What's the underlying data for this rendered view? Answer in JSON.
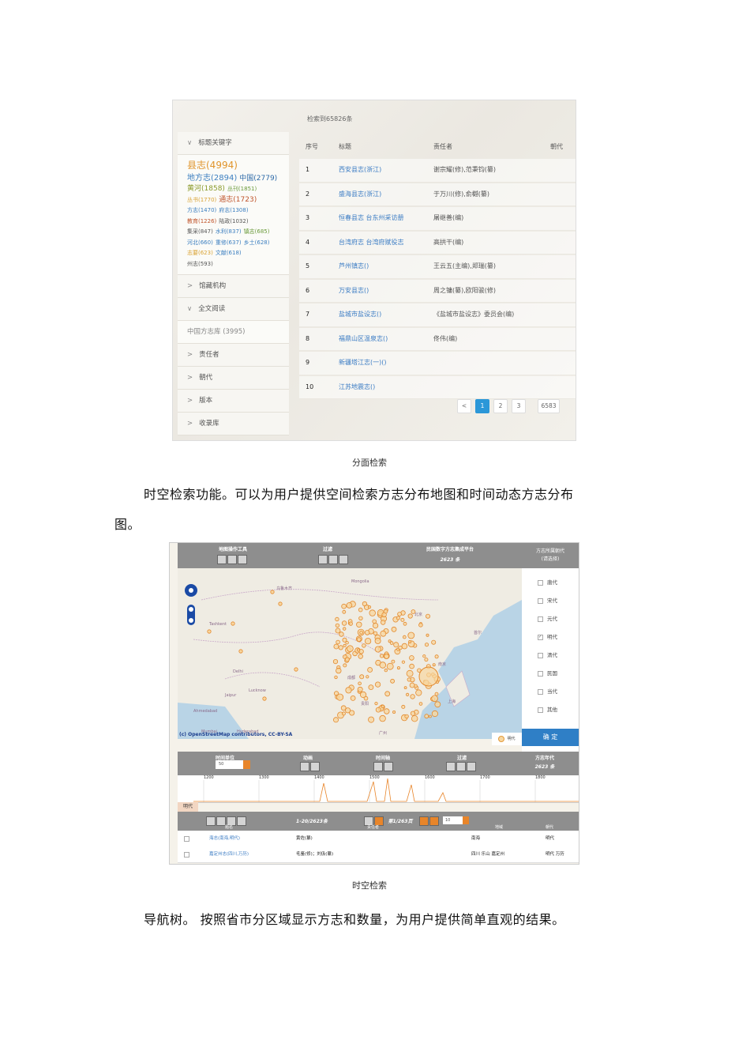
{
  "figure1": {
    "hit_count": "检索到65826条",
    "facets": {
      "title_keyword_label": "标题关键字",
      "keywords": [
        {
          "text": "县志(4994)",
          "size": "big",
          "color": "#e0952c"
        },
        {
          "text": "地方志(2894)",
          "size": "l2",
          "color": "#3c7fc0"
        },
        {
          "text": "中国(2779)",
          "size": "l3",
          "color": "#2d6aa8"
        },
        {
          "text": "黄河(1858)",
          "size": "l3",
          "color": "#8a9a2a"
        },
        {
          "text": "丛刊(1851)",
          "size": "sm",
          "color": "#6a9a3a"
        },
        {
          "text": "丛书(1770)",
          "size": "sm",
          "color": "#d9a232"
        },
        {
          "text": "通志(1723)",
          "size": "l3",
          "color": "#c0552c"
        },
        {
          "text": "方志(1470)",
          "size": "sm",
          "color": "#3c7fc0"
        },
        {
          "text": "府志(1308)",
          "size": "sm",
          "color": "#3c7fc0"
        },
        {
          "text": "教育(1226)",
          "size": "sm",
          "color": "#c0552c"
        },
        {
          "text": "陆政(1032)",
          "size": "sm",
          "color": "#555555"
        },
        {
          "text": "集采(847)",
          "size": "sm",
          "color": "#555555"
        },
        {
          "text": "水利(837)",
          "size": "sm",
          "color": "#3c7fc0"
        },
        {
          "text": "镇志(685)",
          "size": "sm",
          "color": "#6a9a3a"
        },
        {
          "text": "河北(660)",
          "size": "sm",
          "color": "#3c7fc0"
        },
        {
          "text": "重修(637)",
          "size": "sm",
          "color": "#3c7fc0"
        },
        {
          "text": "乡土(628)",
          "size": "sm",
          "color": "#3c7fc0"
        },
        {
          "text": "志要(623)",
          "size": "sm",
          "color": "#d9a232"
        },
        {
          "text": "文献(618)",
          "size": "sm",
          "color": "#3c7fc0"
        },
        {
          "text": "州志(593)",
          "size": "sm",
          "color": "#555555"
        }
      ],
      "collection_label": "馆藏机构",
      "fulltext_label": "全文阅读",
      "fulltext_item": "中国方志库 (3995)",
      "responsible_label": "责任者",
      "dynasty_label": "朝代",
      "edition_label": "版本",
      "library_label": "收录库"
    },
    "table": {
      "headers": [
        "序号",
        "标题",
        "责任者",
        "朝代"
      ],
      "rows": [
        [
          "1",
          "西安县志(浙江)",
          "谢宗耀(修),范秉钧(纂)",
          ""
        ],
        [
          "2",
          "盛海县志(浙江)",
          "于万川(修),俞樾(纂)",
          ""
        ],
        [
          "3",
          "恒春县志 台东州采访册",
          "屠继善(编)",
          ""
        ],
        [
          "4",
          "台湾府志 台湾府赋役志",
          "高拱干(编)",
          ""
        ],
        [
          "5",
          "芦州镇志()",
          "王云五(主编),郑瑞(纂)",
          ""
        ],
        [
          "6",
          "万安县志()",
          "周之镛(纂),欧阳骏(修)",
          ""
        ],
        [
          "7",
          "盐城市盐设志()",
          "《盐城市盐设志》委员会(编)",
          ""
        ],
        [
          "8",
          "福鼎山区温泉志()",
          "佟伟(编)",
          ""
        ],
        [
          "9",
          "新疆塔江志(一)()",
          "",
          ""
        ],
        [
          "10",
          "江苏地震志()",
          "",
          ""
        ]
      ]
    },
    "pager": [
      "<",
      "1",
      "2",
      "3",
      "6583"
    ]
  },
  "caption1": "分面检索",
  "para1_line1": "时空检索功能。可以为用户提供空间检索方志分布地图和时间动态方志分布",
  "para1_line2": "图。",
  "figure2": {
    "toolbar": {
      "map_tools": "地图操作工具",
      "filter": "过滤",
      "platform": "民国数字方志集成平台",
      "records": "2623 条",
      "dynasty_head": "方志所属朝代",
      "dynasty_sub": "(请选择)"
    },
    "dynasties": [
      {
        "label": "唐代",
        "checked": false
      },
      {
        "label": "宋代",
        "checked": false
      },
      {
        "label": "元代",
        "checked": false
      },
      {
        "label": "明代",
        "checked": true
      },
      {
        "label": "清代",
        "checked": false
      },
      {
        "label": "民国",
        "checked": false
      },
      {
        "label": "当代",
        "checked": false
      },
      {
        "label": "其他",
        "checked": false
      }
    ],
    "confirm": "确 定",
    "legend": "明代",
    "osm": "(c) OpenStreetMap contributors, CC-BY-SA",
    "map_labels": [
      "乌鲁木齐",
      "Mongolia",
      "Tashkent",
      "Delhi",
      "Lucknow",
      "Jaipur",
      "Ahmedabad",
      "Mumbai",
      "Hyderabad",
      "成都",
      "贵阳",
      "广州",
      "北京",
      "上海",
      "首尔",
      "南京"
    ],
    "tl_header": [
      "时间单位",
      "动画",
      "时间轴",
      "过滤",
      "方志年代"
    ],
    "tl_records": "2623 条",
    "tl_unit": "50",
    "timeline_ticks": [
      "1200",
      "1300",
      "1400",
      "1500",
      "1600",
      "1700",
      "1800"
    ],
    "era_tab": "明代",
    "list_toolbar": "1-20/2623条",
    "list_pages": "第1/263页",
    "list_size": "10",
    "list_headers": [
      "题名",
      "责任者",
      "地域",
      "朝代"
    ],
    "list_rows": [
      [
        "海志(南海,明代)",
        "黄佐(纂)",
        "南海",
        "明代"
      ],
      [
        "嘉定州志(四川,万历)",
        "毛鉴(修)；刘伋(纂)",
        "四川 乐山 嘉定州",
        "明代 万历"
      ]
    ]
  },
  "caption2": "时空检索",
  "para2": "导航树。 按照省市分区域显示方志和数量，为用户提供简单直观的结果。"
}
